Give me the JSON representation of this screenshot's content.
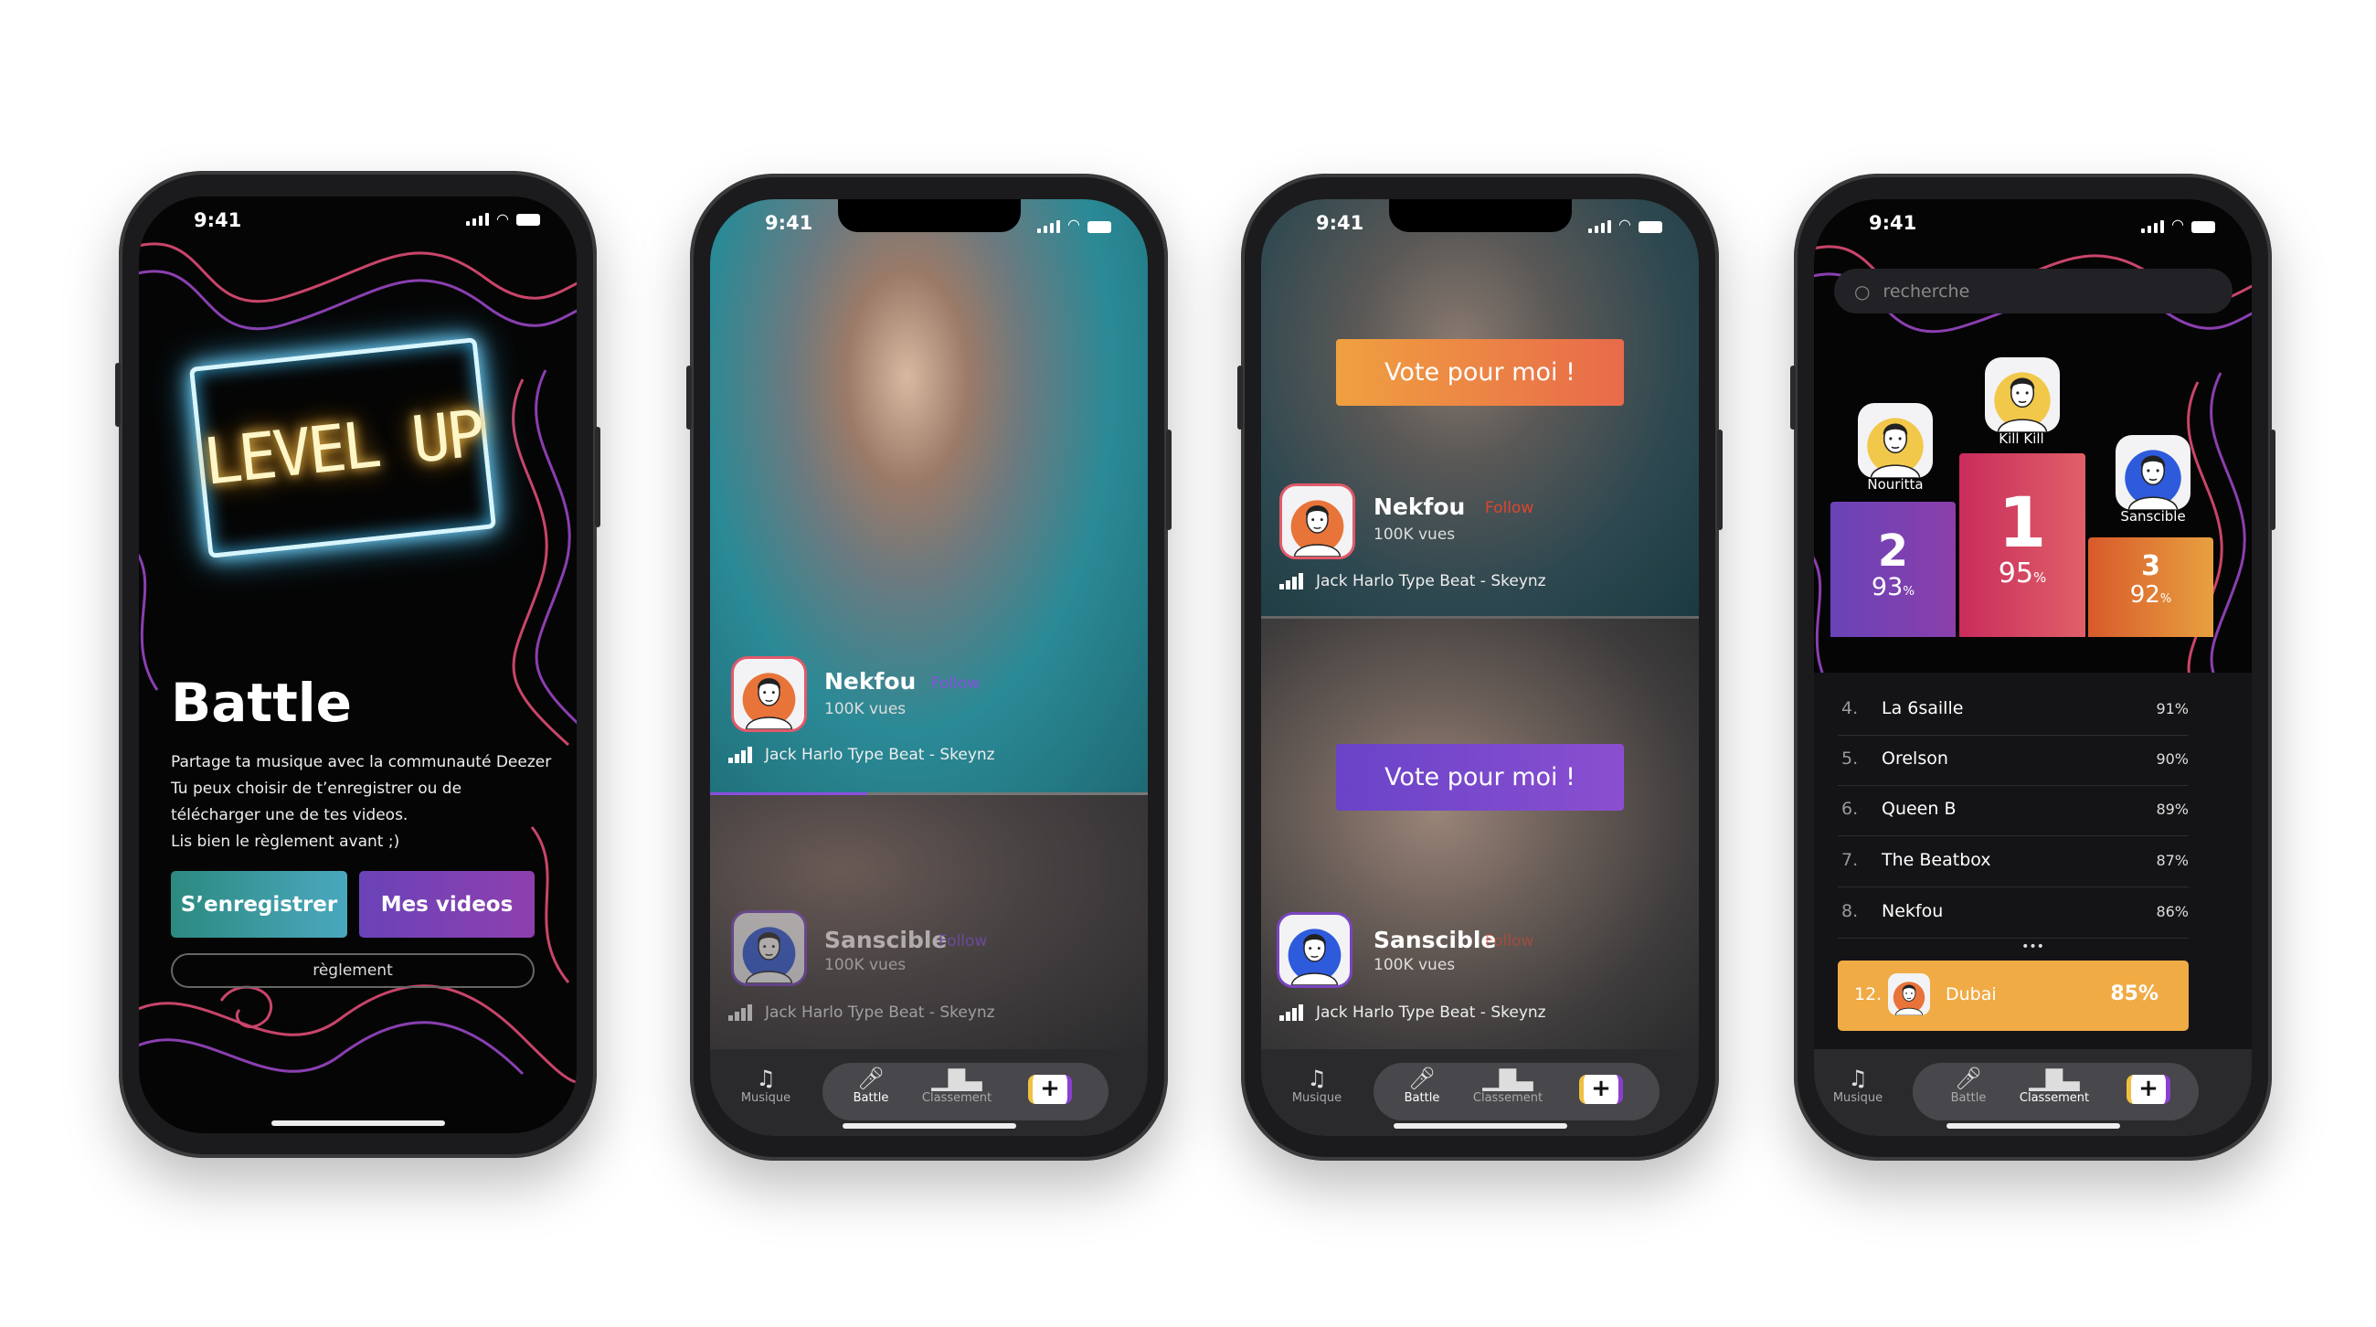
{
  "status": {
    "time": "9:41"
  },
  "screen_intro": {
    "logo_text": "LEVEL UP",
    "title": "Battle",
    "paragraph": [
      "Partage ta musique avec la communauté Deezer",
      "Tu peux choisir de t’enregistrer ou de",
      "télécharger une de tes videos.",
      "Lis bien le règlement avant ;)"
    ],
    "record_button": "S’enregistrer",
    "videos_button": "Mes videos",
    "rules_button": "règlement"
  },
  "screen_battle": {
    "entries": [
      {
        "name": "Nekfou",
        "follow": "Follow",
        "views": "100K vues",
        "song": "Jack Harlo Type Beat - Skeynz"
      },
      {
        "name": "Sanscible",
        "follow": "Follow",
        "views": "100K vues",
        "song": "Jack Harlo Type Beat - Skeynz"
      }
    ],
    "progress": 0.36
  },
  "screen_vote": {
    "vote_label": "Vote pour moi !",
    "entries": [
      {
        "name": "Nekfou",
        "follow": "Follow",
        "views": "100K vues",
        "song": "Jack Harlo Type Beat - Skeynz"
      },
      {
        "name": "Sanscible",
        "follow": "Follow",
        "views": "100K vues",
        "song": "Jack Harlo Type Beat - Skeynz"
      }
    ]
  },
  "screen_ranking": {
    "search_placeholder": "recherche",
    "podium": [
      {
        "rank": "2",
        "name": "Nouritta",
        "percent": "93",
        "unit": "%"
      },
      {
        "rank": "1",
        "name": "Kill Kill",
        "percent": "95",
        "unit": "%"
      },
      {
        "rank": "3",
        "name": "Sanscible",
        "percent": "92",
        "unit": "%"
      }
    ],
    "list": [
      {
        "rank": "4.",
        "name": "La 6saille",
        "percent": "91%"
      },
      {
        "rank": "5.",
        "name": "Orelson",
        "percent": "90%"
      },
      {
        "rank": "6.",
        "name": "Queen B",
        "percent": "89%"
      },
      {
        "rank": "7.",
        "name": "The Beatbox",
        "percent": "87%"
      },
      {
        "rank": "8.",
        "name": "Nekfou",
        "percent": "86%"
      }
    ],
    "more": "•••",
    "me": {
      "rank": "12.",
      "name": "Dubai",
      "percent": "85%"
    }
  },
  "nav": {
    "music": "Musique",
    "battle": "Battle",
    "ranking": "Classement",
    "add": "+"
  },
  "colors": {
    "teal": "#2f8f86",
    "purple": "#7a45c0",
    "pink": "#d13a62",
    "orange": "#e5762e",
    "gold": "#f0ab45",
    "follow_purple": "#8a4fe0",
    "follow_red": "#e0452f"
  }
}
